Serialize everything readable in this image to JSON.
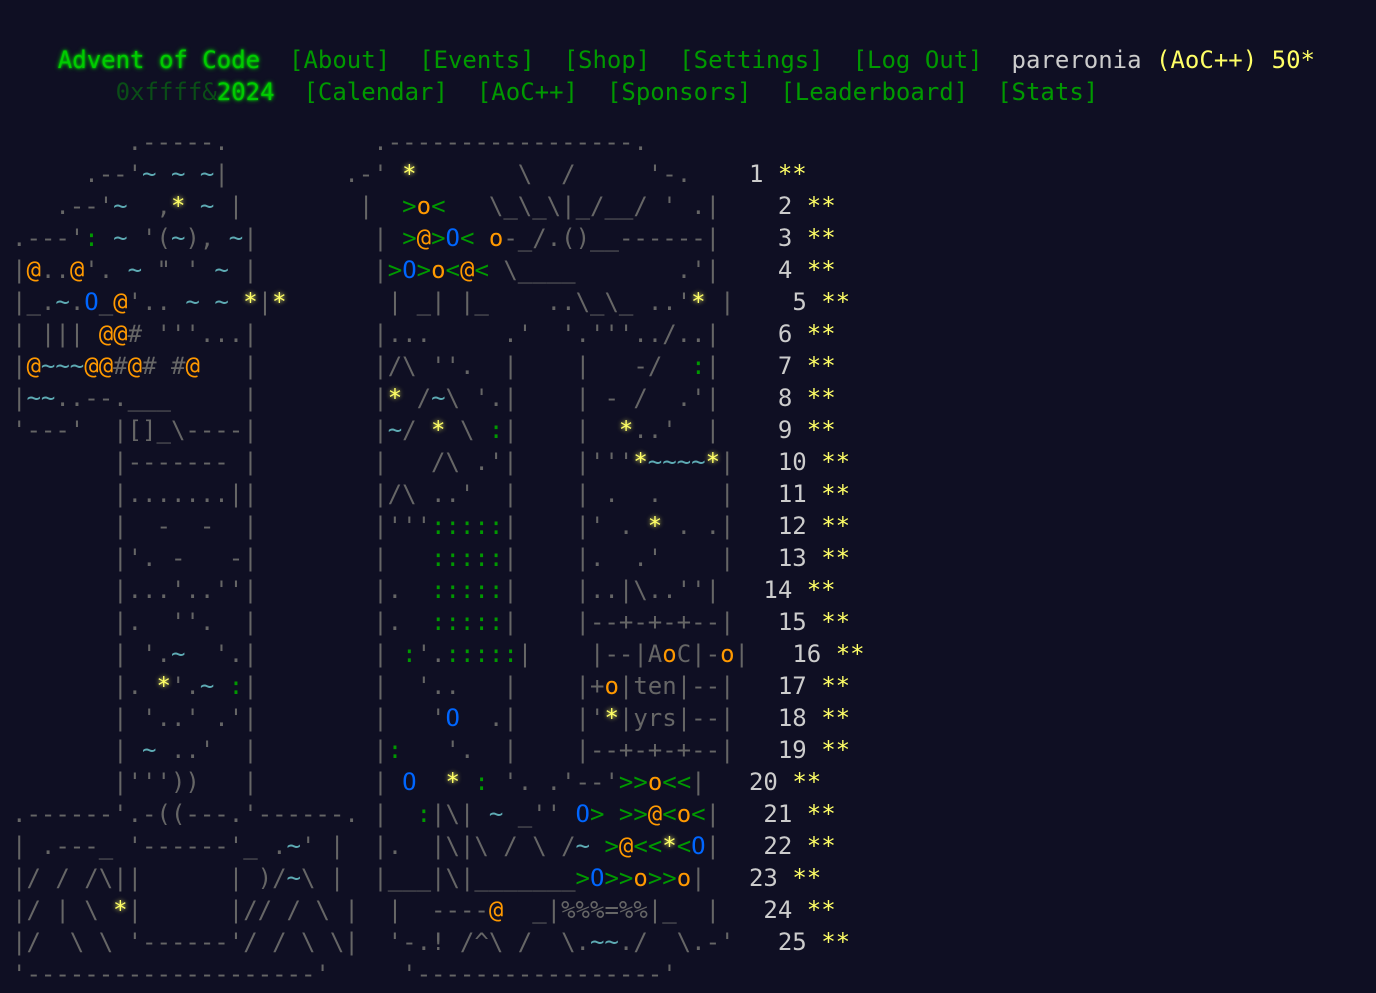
{
  "header": {
    "title": "Advent of Code",
    "year_prefix": "0xffff&",
    "year": "2024",
    "nav_row1": [
      "[About]",
      "[Events]",
      "[Shop]",
      "[Settings]",
      "[Log Out]"
    ],
    "nav_row2": [
      "[Calendar]",
      "[AoC++]",
      "[Sponsors]",
      "[Leaderboard]",
      "[Stats]"
    ],
    "user": "pareronia",
    "aocpp_badge": "(AoC++)",
    "star_count": "50*"
  },
  "calendar": {
    "art_top": [
      "        .-----.          .-----------------.",
      "     .--'~ ~ ~|        .-'  *       \\  /     '-.",
      "  .--'~  ,* ~ |        |  >o<   \\_\\_\\|_/__/ ' . |",
      ".---': ~ '(~), ~|        | >@>O< o-_/.()__------|",
      "|@..@'. ~ \" ' ~ |        |>O>o<@< \\____       .'|",
      "|_.~.0_@'.. ~ ~ *|*       | _| |_    ..\\_\\_ ..'* |",
      "| ||| @@# '''...|        |...     .'  '.'''../..|",
      "|@~~~@@#@# #@   |        |/\\ ''.  |    |   -/  :|"
    ],
    "days": [
      {
        "n": "1",
        "stars": "**"
      },
      {
        "n": "2",
        "stars": "**"
      },
      {
        "n": "3",
        "stars": "**"
      },
      {
        "n": "4",
        "stars": "**"
      },
      {
        "n": "5",
        "stars": "**"
      },
      {
        "n": "6",
        "stars": "**"
      },
      {
        "n": "7",
        "stars": "**"
      },
      {
        "n": "8",
        "stars": "**"
      },
      {
        "n": "9",
        "stars": "**"
      },
      {
        "n": "10",
        "stars": "**"
      },
      {
        "n": "11",
        "stars": "**"
      },
      {
        "n": "12",
        "stars": "**"
      },
      {
        "n": "13",
        "stars": "**"
      },
      {
        "n": "14",
        "stars": "**"
      },
      {
        "n": "15",
        "stars": "**"
      },
      {
        "n": "16",
        "stars": "**"
      },
      {
        "n": "17",
        "stars": "**"
      },
      {
        "n": "18",
        "stars": "**"
      },
      {
        "n": "19",
        "stars": "**"
      },
      {
        "n": "20",
        "stars": "**"
      },
      {
        "n": "21",
        "stars": "**"
      },
      {
        "n": "22",
        "stars": "**"
      },
      {
        "n": "23",
        "stars": "**"
      },
      {
        "n": "24",
        "stars": "**"
      },
      {
        "n": "25",
        "stars": "**"
      }
    ],
    "art_lines": [
      [
        "        .-----.          .-----------------.     "
      ],
      [
        "     .--'~ ~ ~|        .-' * ",
        "      \\  /     '-.   "
      ],
      [
        "   .--'~  ,* ~ |        |  >o<   \\_\\_\\|_/__/ ' .|   "
      ],
      [
        ".---': ~ '(~), ~|        | >@>O< o-_/.()__------|   "
      ],
      [
        "|@..@'. ~ \" ' ~ |        |>O>o<@< \\____       .'|   "
      ],
      [
        "|_.~.O_@'.. ~ ~ *|*       | _| |_    ..\\_\\_ ..'* |   "
      ],
      [
        "| ||| @@# '''...|        |...     .'  '.'''../..|   "
      ],
      [
        "|@~~~@@#@# #@   |        |/\\ ''.  |    |   -/  :|   "
      ],
      [
        "|~~..--.___     |        |* /~\\ '.|    | - /  .'|   "
      ],
      [
        "'---'  |[]_\\----|        |~/ * \\ :|    |  *..'  |   "
      ],
      [
        "       |------- |        |   /\\ .'|    |'''*~~~~*|   "
      ],
      [
        "       |.......||        |/\\ ..'  |    | .  .    |   "
      ],
      [
        "       |  -  -  |        |''':::::|    |' . * . .|   "
      ],
      [
        "       |'. -   -|        |   :::::|    |.  .'    |   "
      ],
      [
        "       |...'..''|        |.  :::::|    |..|\\..''|   "
      ],
      [
        "       |.  ''.  |        |.  :::::|    |--+-+-+--|   "
      ],
      [
        "       | '.~  '.|        | :'.:::::|    |--|AoC|-o|   "
      ],
      [
        "       |. *'.~ :|        |  '..   |    |+o|ten|--|   "
      ],
      [
        "       | '..' .'|        |   'O  .|    |'*|yrs|--|   "
      ],
      [
        "       | ~ ..'  |        |:   '.  |    |--+-+-+--|   "
      ],
      [
        "       |'''))   |        | O  * : '. .'--'>>o<<|   "
      ],
      [
        ".------'.-((---.'------. |  :|\\| ~ _'' O> >>@<o<|   "
      ],
      [
        "| .---_ '------'_ .~' |  |.  |\\|\\ / \\ /~ >@<<*<O|   "
      ],
      [
        "|/ / /\\||      | )/~\\ |  |___|\\|_______>O>>o>>o|   "
      ],
      [
        "|/ | \\ *|      |// / \\ |  |  ----@  _|%%%=%%|_  |   "
      ],
      [
        "|/  \\ \\ '------'/ / \\ \\|  '-.! /^\\ /  \\.~~./  \\.-'   "
      ],
      [
        "'--------------------'     '-----------------'      "
      ]
    ]
  },
  "colors": {
    "background": "#0f0f23",
    "text": "#cccccc",
    "title_green": "#00cc00",
    "link_green": "#009900",
    "star_yellow": "#ffff66",
    "orange": "#ff9900",
    "red": "#ff0000",
    "blue": "#0066ff",
    "cyan": "#5eabb4"
  }
}
